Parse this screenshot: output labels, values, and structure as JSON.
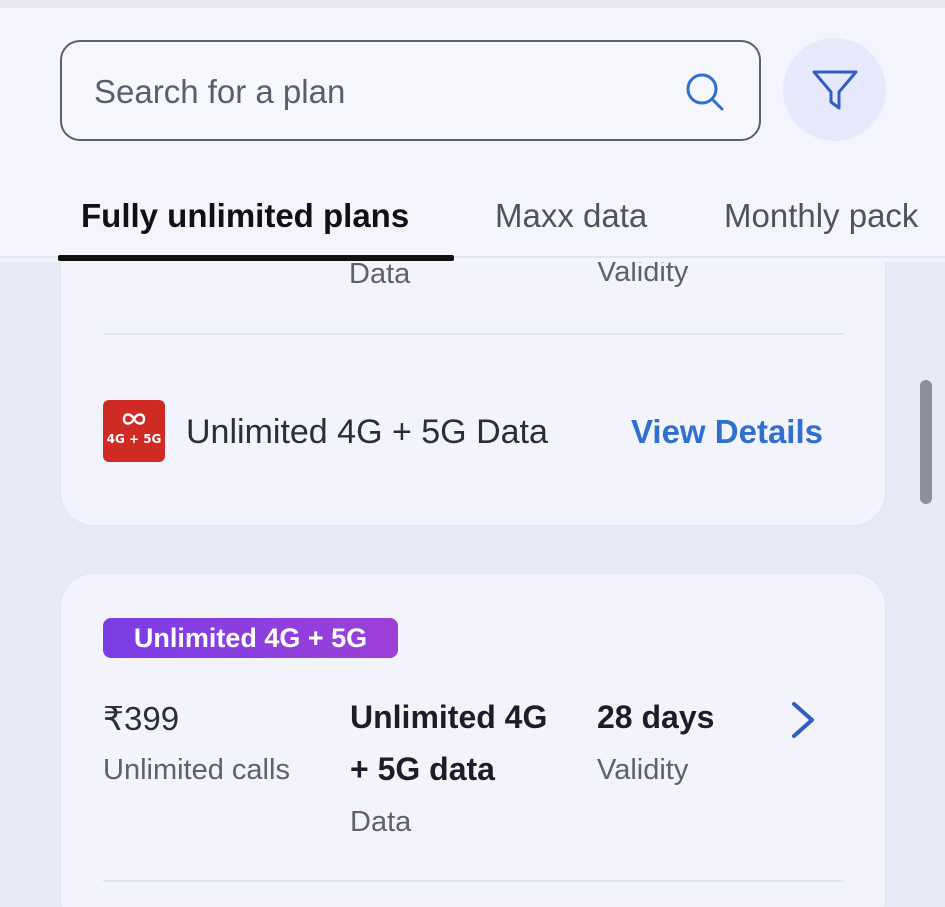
{
  "search": {
    "placeholder": "Search for a plan"
  },
  "tabs": [
    {
      "label": "Fully unlimited plans",
      "active": true
    },
    {
      "label": "Maxx data",
      "active": false
    },
    {
      "label": "Monthly pack",
      "active": false
    }
  ],
  "card1": {
    "data_label": "Data",
    "validity_label": "Validity",
    "badge_text": "4G + 5G",
    "feature": "Unlimited 4G + 5G Data",
    "view_details": "View Details"
  },
  "card2": {
    "pill": "Unlimited 4G + 5G",
    "price": "₹399",
    "calls": "Unlimited calls",
    "data_line1": "Unlimited 4G",
    "data_line2": "+ 5G data",
    "data_label": "Data",
    "validity_value": "28 days",
    "validity_label": "Validity"
  },
  "colors": {
    "accent_blue": "#2f6fcf",
    "badge_red": "#d02a25",
    "pill_purple": "#7a3ee6"
  },
  "icons": [
    "search-icon",
    "filter-icon",
    "unlimited-4g5g-icon",
    "chevron-right-icon"
  ]
}
